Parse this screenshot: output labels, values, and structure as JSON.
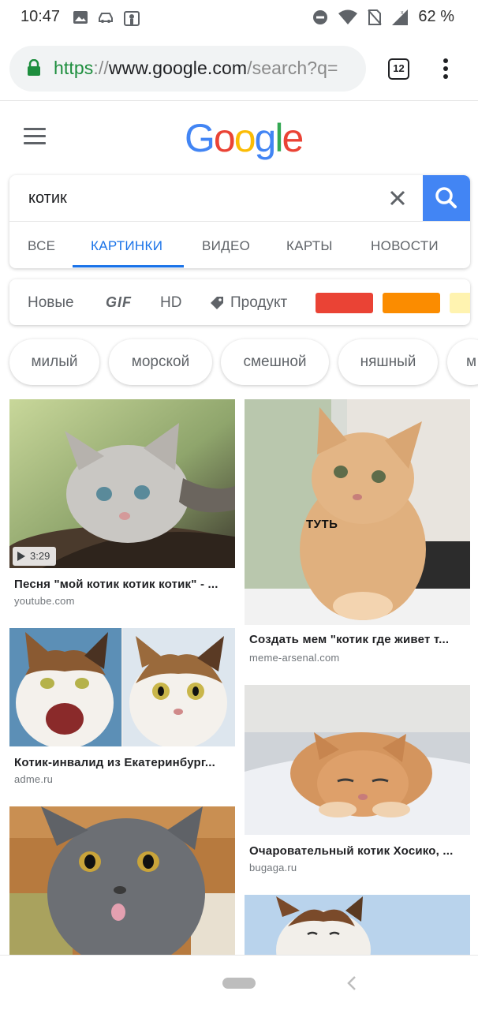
{
  "status": {
    "time": "10:47",
    "battery": "62 %"
  },
  "browser": {
    "url_scheme": "https",
    "url_sep": "://",
    "url_host": "www.google.com",
    "url_path": "/search?q=",
    "tab_count": "12"
  },
  "google": {
    "logo_letters": [
      "G",
      "o",
      "o",
      "g",
      "l",
      "e"
    ],
    "logo_colors": [
      "#4285f4",
      "#ea4335",
      "#fbbc05",
      "#4285f4",
      "#34a853",
      "#ea4335"
    ]
  },
  "search": {
    "query": "котик"
  },
  "tabs": [
    "ВСЕ",
    "КАРТИНКИ",
    "ВИДЕО",
    "КАРТЫ",
    "НОВОСТИ"
  ],
  "active_tab": "КАРТИНКИ",
  "filters": {
    "new": "Новые",
    "gif": "GIF",
    "hd": "HD",
    "product": "Продукт",
    "color_swatches": [
      "#ea4335",
      "#fb8c00",
      "#fff3b0"
    ]
  },
  "chips": [
    "милый",
    "морской",
    "смешной",
    "няшный",
    "м"
  ],
  "results": [
    {
      "title": "Песня \"мой котик котик котик\" - ...",
      "domain": "youtube.com",
      "duration": "3:29"
    },
    {
      "title": "Создать мем \"котик где живет т...",
      "domain": "meme-arsenal.com",
      "overlay_text": "ТУТЬ"
    },
    {
      "title": "Котик-инвалид из Екатеринбург...",
      "domain": "adme.ru"
    },
    {
      "title": "Очаровательный котик Хосико, ...",
      "domain": "bugaga.ru"
    }
  ]
}
